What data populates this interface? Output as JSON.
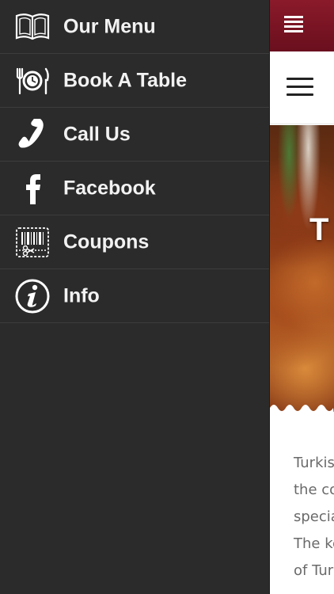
{
  "drawer": {
    "items": [
      {
        "label": "Our Menu",
        "icon": "book-icon"
      },
      {
        "label": "Book A Table",
        "icon": "clock-cutlery-icon"
      },
      {
        "label": "Call Us",
        "icon": "phone-icon"
      },
      {
        "label": "Facebook",
        "icon": "facebook-icon"
      },
      {
        "label": "Coupons",
        "icon": "coupon-icon"
      },
      {
        "label": "Info",
        "icon": "info-icon"
      }
    ]
  },
  "page": {
    "hero_letter": "T",
    "text_lines": [
      "Turkis",
      "the co",
      "specia",
      "The ke",
      "of Tur"
    ]
  },
  "colors": {
    "drawer_bg": "#2b2b2b",
    "topbar": "#7a1424",
    "divider": "#3d3d3d"
  }
}
